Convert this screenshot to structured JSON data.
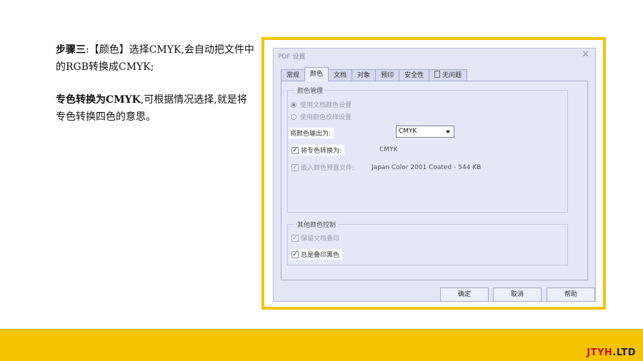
{
  "instructions": {
    "p1_bold": "步骤三",
    "p1_rest": ":【颜色】选择CMYK,会自动把文件中的RGB转换成CMYK;",
    "p2_bold": "专色转换为CMYK",
    "p2_rest": ",可根据情况选择,就是将专色转换四色的意思。"
  },
  "dialog": {
    "title": "PDF 设置",
    "close_glyph": "✕",
    "tabs": [
      {
        "label": "常规"
      },
      {
        "label": "颜色",
        "active": true
      },
      {
        "label": "文档"
      },
      {
        "label": "对象"
      },
      {
        "label": "预印"
      },
      {
        "label": "安全性"
      },
      {
        "label": "无问题"
      }
    ],
    "color_mgmt": {
      "legend": "颜色管理",
      "radio1": "使用文档颜色设置",
      "radio2": "使用颜色校样设置",
      "output_label": "将颜色输出为:",
      "output_value": "CMYK",
      "spot_label": "将专色转换为:",
      "spot_value": "CMYK",
      "embed_label": "嵌入颜色预置文件:",
      "embed_value": "Japan Color 2001 Coated - 544 KB"
    },
    "other": {
      "legend": "其他颜色控制",
      "preserve_overprint": "保留文档叠印",
      "always_overprint_black": "总是叠印黑色"
    },
    "buttons": {
      "ok": "确定",
      "cancel": "取消",
      "help": "帮助"
    }
  },
  "brand": {
    "part1": "JTYH",
    "part2": ".LTD"
  }
}
